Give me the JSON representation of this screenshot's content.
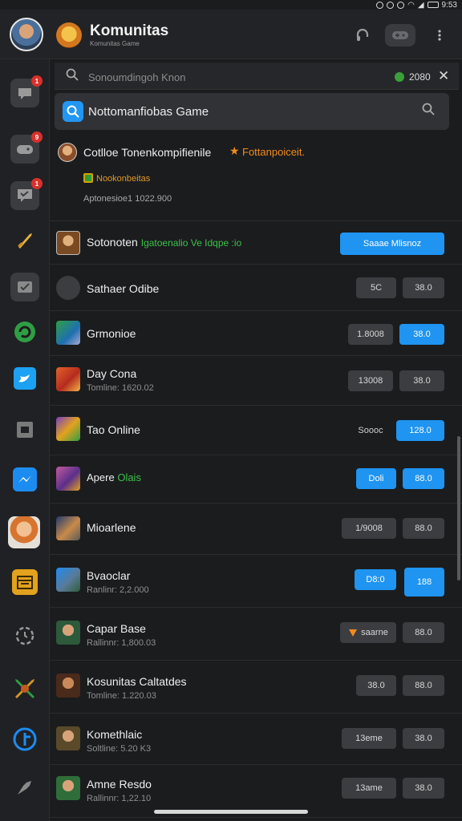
{
  "status_bar": {
    "time": "9:53"
  },
  "header": {
    "title": "Komunitas",
    "subtitle": "Komunitas Game",
    "icons": [
      "headset-icon",
      "gamepad-icon",
      "more-vert-icon"
    ]
  },
  "sidebar": {
    "items": [
      {
        "icon": "chat-icon",
        "badge": "1"
      },
      {
        "icon": "gamepad-icon",
        "badge": "9"
      },
      {
        "icon": "message-icon",
        "badge": "1"
      },
      {
        "icon": "sword-icon",
        "badge": ""
      },
      {
        "icon": "check-icon",
        "badge": ""
      },
      {
        "icon": "refresh-icon",
        "badge": ""
      },
      {
        "icon": "bird-icon",
        "badge": ""
      },
      {
        "icon": "square-icon",
        "badge": ""
      },
      {
        "icon": "messenger-icon",
        "badge": ""
      },
      {
        "icon": "character-icon",
        "badge": ""
      },
      {
        "icon": "calendar-icon",
        "badge": ""
      },
      {
        "icon": "clock-icon",
        "badge": ""
      },
      {
        "icon": "fight-icon",
        "badge": ""
      },
      {
        "icon": "plus-circle-icon",
        "badge": ""
      },
      {
        "icon": "pin-icon",
        "badge": ""
      }
    ]
  },
  "search": {
    "placeholder": "Sonoumdingoh Knon",
    "count": "2080",
    "close": "✕"
  },
  "game_search": {
    "label": "Nottomanfiobas Game"
  },
  "featured": {
    "title": "Cotlloe Tonenkompifienile",
    "star": "★",
    "highlight": "Fottanpoiceit.",
    "tag": "Nookonbeitas",
    "meta": "Aptonesioe1 1022.900"
  },
  "rows": [
    {
      "title": "Sotonoten",
      "suffix": "Igatoenalio Ve Idqpe :io",
      "sub": "",
      "btn1": "",
      "btn2": "Saaae Mlisnoz"
    },
    {
      "title": "Sathaer Odibe",
      "suffix": "",
      "sub": "",
      "btn1": "5C",
      "btn2": "38.0"
    },
    {
      "title": "Grmonioe",
      "suffix": "",
      "sub": "",
      "btn1": "1.8008",
      "btn2": "38.0"
    },
    {
      "title": "Day Cona",
      "suffix": "",
      "sub": "Tomline: 1620.02",
      "btn1": "13008",
      "btn2": "38.0"
    },
    {
      "title": "Tao Online",
      "suffix": "",
      "sub": "",
      "btn1": "Soooc",
      "btn2": "128.0"
    },
    {
      "title": "Apere",
      "suffix": "Olais",
      "sub": "",
      "btn1": "Doli",
      "btn2": "88.0"
    },
    {
      "title": "Mioarlene",
      "suffix": "",
      "sub": "",
      "btn1": "1/9008",
      "btn2": "88.0"
    },
    {
      "title": "Bvaoclar",
      "suffix": "",
      "sub": "Ranlinr: 2,2.000",
      "btn1": "D8:0",
      "btn2": "188"
    },
    {
      "title": "Capar Base",
      "suffix": "",
      "sub": "Rallinnr: 1,800.03",
      "btn1": "saarne",
      "btn2": "88.0"
    },
    {
      "title": "Kosunitas Caltatdes",
      "suffix": "",
      "sub": "Tomline: 1.220.03",
      "btn1": "38.0",
      "btn2": "88.0"
    },
    {
      "title": "Komethlaic",
      "suffix": "",
      "sub": "Soltline: 5.20 K3",
      "btn1": "13eme",
      "btn2": "38.0"
    },
    {
      "title": "Amne Resdo",
      "suffix": "",
      "sub": "Rallinnr: 1,22.10",
      "btn1": "13ame",
      "btn2": "38.0"
    }
  ],
  "colors": {
    "accent": "#1f94f0",
    "highlight": "#f28b1c",
    "online": "#3bc24a",
    "background": "#1b1c1e"
  }
}
